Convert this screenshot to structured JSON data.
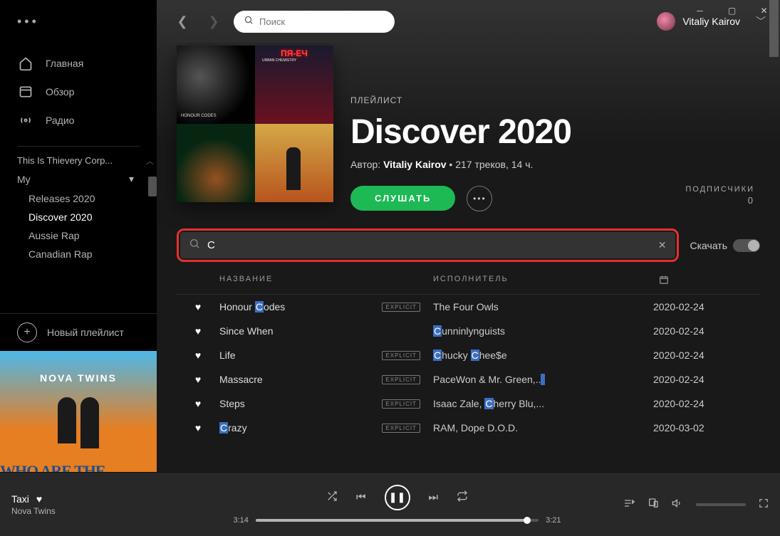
{
  "window": {
    "user": "Vitaliy Kairov"
  },
  "search": {
    "placeholder": "Поиск"
  },
  "nav": {
    "home": "Главная",
    "browse": "Обзор",
    "radio": "Радио"
  },
  "sidebar": {
    "truncated": "This Is Thievery Corp...",
    "folder": "My",
    "items": [
      "Releases 2020",
      "Discover 2020",
      "Aussie Rap",
      "Canadian Rap"
    ],
    "activeIndex": 1,
    "newPlaylist": "Новый плейлист"
  },
  "cover_art": {
    "artist": "NOVA TWINS",
    "bottom": "WHO ARE THE GIRLS?"
  },
  "playlist": {
    "type": "ПЛЕЙЛИСТ",
    "title": "Discover 2020",
    "byLabel": "Автор:",
    "author": "Vitaliy Kairov",
    "meta": "217 треков, 14 ч.",
    "play": "СЛУШАТЬ",
    "subscribersLabel": "ПОДПИСЧИКИ",
    "subscribersCount": "0"
  },
  "filter": {
    "value": "С",
    "downloadLabel": "Скачать"
  },
  "columns": {
    "title": "НАЗВАНИЕ",
    "artist": "ИСПОЛНИТЕЛЬ"
  },
  "tracks": [
    {
      "title_pre": "Honour ",
      "title_hl": "C",
      "title_post": "odes",
      "explicit": true,
      "artist_pre": "The Four Owls",
      "artist_hl": "",
      "artist_post": "",
      "date": "2020-02-24"
    },
    {
      "title_pre": "Since When",
      "title_hl": "",
      "title_post": "",
      "explicit": false,
      "artist_pre": "",
      "artist_hl": "C",
      "artist_post": "unninlynguists",
      "date": "2020-02-24"
    },
    {
      "title_pre": "Life",
      "title_hl": "",
      "title_post": "",
      "explicit": true,
      "artist_pre": "",
      "artist_hl": "C",
      "artist_post": "hucky ",
      "artist_hl2": "C",
      "artist_post2": "hee$e",
      "date": "2020-02-24"
    },
    {
      "title_pre": "Massacre",
      "title_hl": "",
      "title_post": "",
      "explicit": true,
      "artist_pre": "PaceWon & Mr. Green,..",
      "artist_hl": "",
      "artist_post": "",
      "trail_hl": true,
      "date": "2020-02-24"
    },
    {
      "title_pre": "Steps",
      "title_hl": "",
      "title_post": "",
      "explicit": true,
      "artist_pre": "Isaac Zale, ",
      "artist_hl": "C",
      "artist_post": "herry Blu,...",
      "date": "2020-02-24"
    },
    {
      "title_pre": "",
      "title_hl": "C",
      "title_post": "razy",
      "explicit": true,
      "artist_pre": "RAM, Dope D.O.D.",
      "artist_hl": "",
      "artist_post": "",
      "date": "2020-03-02"
    }
  ],
  "player": {
    "track": "Taxi",
    "artist": "Nova Twins",
    "elapsed": "3:14",
    "duration": "3:21",
    "progressPct": 96
  }
}
